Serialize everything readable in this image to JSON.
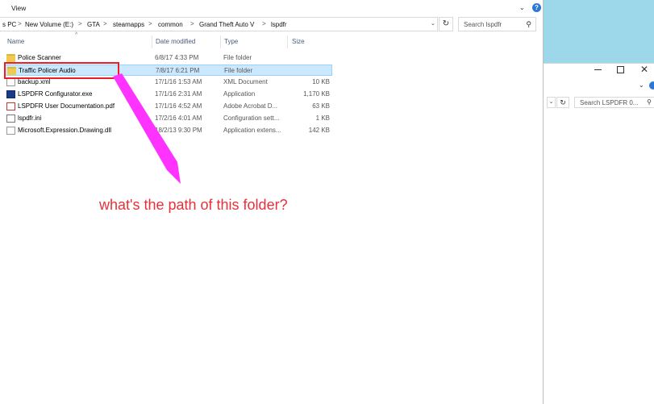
{
  "ribbon": {
    "view_label": "View",
    "help": "?"
  },
  "address": {
    "crumbs": [
      "s PC",
      "New Volume (E:)",
      "GTA",
      "steamapps",
      "common",
      "Grand Theft Auto V",
      "lspdfr"
    ],
    "separator": ">"
  },
  "search": {
    "placeholder": "Search lspdfr"
  },
  "columns": {
    "name": "Name",
    "date": "Date modified",
    "type": "Type",
    "size": "Size"
  },
  "files": [
    {
      "name": "Police Scanner",
      "date": "6/8/17 4:33 PM",
      "type": "File folder",
      "size": "",
      "icon": "folder-icon"
    },
    {
      "name": "Traffic Policer Audio",
      "date": "7/8/17 6:21 PM",
      "type": "File folder",
      "size": "",
      "icon": "folder-icon",
      "selected": true
    },
    {
      "name": "backup.xml",
      "date": "17/1/16 1:53 AM",
      "type": "XML Document",
      "size": "10 KB",
      "icon": "document-icon"
    },
    {
      "name": "LSPDFR Configurator.exe",
      "date": "17/1/16 2:31 AM",
      "type": "Application",
      "size": "1,170 KB",
      "icon": "application-icon"
    },
    {
      "name": "LSPDFR User Documentation.pdf",
      "date": "17/1/16 4:52 AM",
      "type": "Adobe Acrobat D...",
      "size": "63 KB",
      "icon": "pdf-icon"
    },
    {
      "name": "lspdfr.ini",
      "date": "17/2/16 4:01 AM",
      "type": "Configuration sett...",
      "size": "1 KB",
      "icon": "settings-file-icon"
    },
    {
      "name": "Microsoft.Expression.Drawing.dll",
      "date": "18/2/13 9:30 PM",
      "type": "Application extens...",
      "size": "142 KB",
      "icon": "dll-icon"
    }
  ],
  "annotation": {
    "question": "what's the path of this folder?",
    "highlight_color": "#e8202a",
    "arrow_color": "#ff33ff",
    "text_color": "#e8303a"
  },
  "second_window": {
    "search_placeholder": "Search LSPDFR 0...",
    "close_glyph": "✕"
  }
}
